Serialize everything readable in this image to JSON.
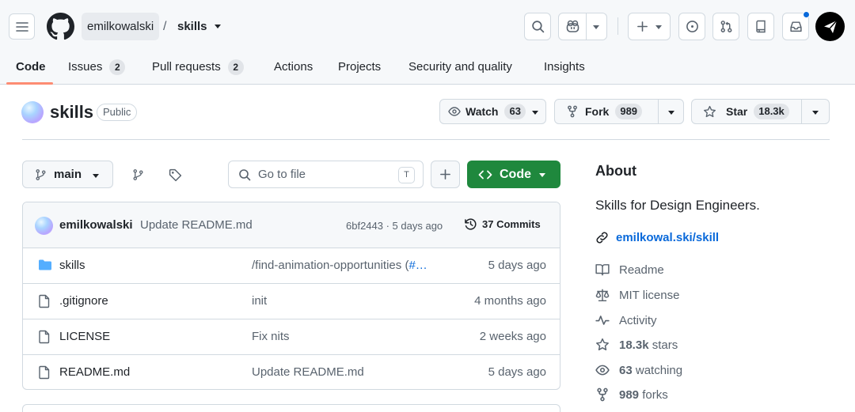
{
  "header": {
    "owner": "emilkowalski",
    "separator": "/",
    "repo": "skills",
    "icons": [
      "menu-icon",
      "github-logo",
      "search-icon",
      "copilot-icon",
      "plus-icon",
      "issue-icon",
      "pull-request-icon",
      "repo-icon",
      "inbox-icon"
    ],
    "notification_color": "#0969da"
  },
  "tabs": [
    {
      "label": "Code",
      "active": true
    },
    {
      "label": "Issues",
      "count": "2"
    },
    {
      "label": "Pull requests",
      "count": "2"
    },
    {
      "label": "Actions"
    },
    {
      "label": "Projects"
    },
    {
      "label": "Security and quality"
    },
    {
      "label": "Insights"
    }
  ],
  "repo": {
    "name": "skills",
    "visibility": "Public",
    "watch": {
      "label": "Watch",
      "count": "63"
    },
    "fork": {
      "label": "Fork",
      "count": "989"
    },
    "star": {
      "label": "Star",
      "count": "18.3k"
    }
  },
  "filenav": {
    "branch": "main",
    "goto_placeholder": "Go to file",
    "goto_shortcut": "T",
    "code_label": "Code"
  },
  "commit": {
    "author": "emilkowalski",
    "message": "Update README.md",
    "meta": "6bf2443 · 5 days ago",
    "commits": "37 Commits"
  },
  "files": [
    {
      "name": "skills",
      "type": "folder",
      "message": "/find-animation-opportunities (",
      "link": "#…",
      "age": "5 days ago"
    },
    {
      "name": ".gitignore",
      "type": "file",
      "message": "init",
      "age": "4 months ago"
    },
    {
      "name": "LICENSE",
      "type": "file",
      "message": "Fix nits",
      "age": "2 weeks ago"
    },
    {
      "name": "README.md",
      "type": "file",
      "message": "Update README.md",
      "age": "5 days ago"
    }
  ],
  "about": {
    "heading": "About",
    "description": "Skills for Design Engineers.",
    "website": "emilkowal.ski/skill",
    "readme": "Readme",
    "license": "MIT license",
    "activity": "Activity",
    "stars_count": "18.3k",
    "stars_label": "stars",
    "watching_count": "63",
    "watching_label": "watching",
    "forks_count": "989",
    "forks_label": "forks"
  },
  "colors": {
    "accent_green": "#1f883d",
    "link_blue": "#0969da",
    "tab_underline": "#fd8c73"
  }
}
